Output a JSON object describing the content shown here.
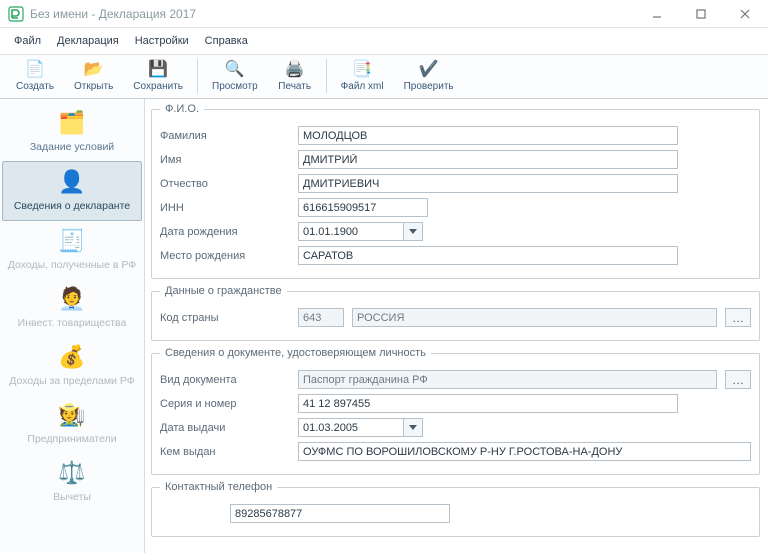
{
  "window": {
    "title": "Без имени - Декларация 2017"
  },
  "menu": {
    "file": "Файл",
    "declaration": "Декларация",
    "settings": "Настройки",
    "help": "Справка"
  },
  "toolbar": {
    "create": "Создать",
    "open": "Открыть",
    "save": "Сохранить",
    "preview": "Просмотр",
    "print": "Печать",
    "filexml": "Файл xml",
    "check": "Проверить"
  },
  "sidebar": {
    "conditions": "Задание условий",
    "declarant": "Сведения о декларанте",
    "income_rf": "Доходы, полученные в РФ",
    "invest": "Инвест. товарищества",
    "income_abroad": "Доходы за пределами РФ",
    "entrepreneurs": "Предприниматели",
    "deductions": "Вычеты"
  },
  "fio": {
    "legend": "Ф.И.О.",
    "surname_lbl": "Фамилия",
    "surname": "МОЛОДЦОВ",
    "name_lbl": "Имя",
    "name": "ДМИТРИЙ",
    "patronymic_lbl": "Отчество",
    "patronymic": "ДМИТРИЕВИЧ",
    "inn_lbl": "ИНН",
    "inn": "616615909517",
    "dob_lbl": "Дата рождения",
    "dob": "01.01.1900",
    "pob_lbl": "Место рождения",
    "pob": "САРАТОВ"
  },
  "citizenship": {
    "legend": "Данные о гражданстве",
    "code_lbl": "Код страны",
    "code": "643",
    "country": "РОССИЯ"
  },
  "doc": {
    "legend": "Сведения о документе, удостоверяющем личность",
    "kind_lbl": "Вид документа",
    "kind": "Паспорт гражданина РФ",
    "serial_lbl": "Серия и номер",
    "serial": "41 12 897455",
    "issued_date_lbl": "Дата выдачи",
    "issued_date": "01.03.2005",
    "issued_by_lbl": "Кем выдан",
    "issued_by": "ОУФМС ПО ВОРОШИЛОВСКОМУ Р-НУ Г.РОСТОВА-НА-ДОНУ"
  },
  "contact": {
    "legend": "Контактный телефон",
    "phone": "89285678877"
  }
}
